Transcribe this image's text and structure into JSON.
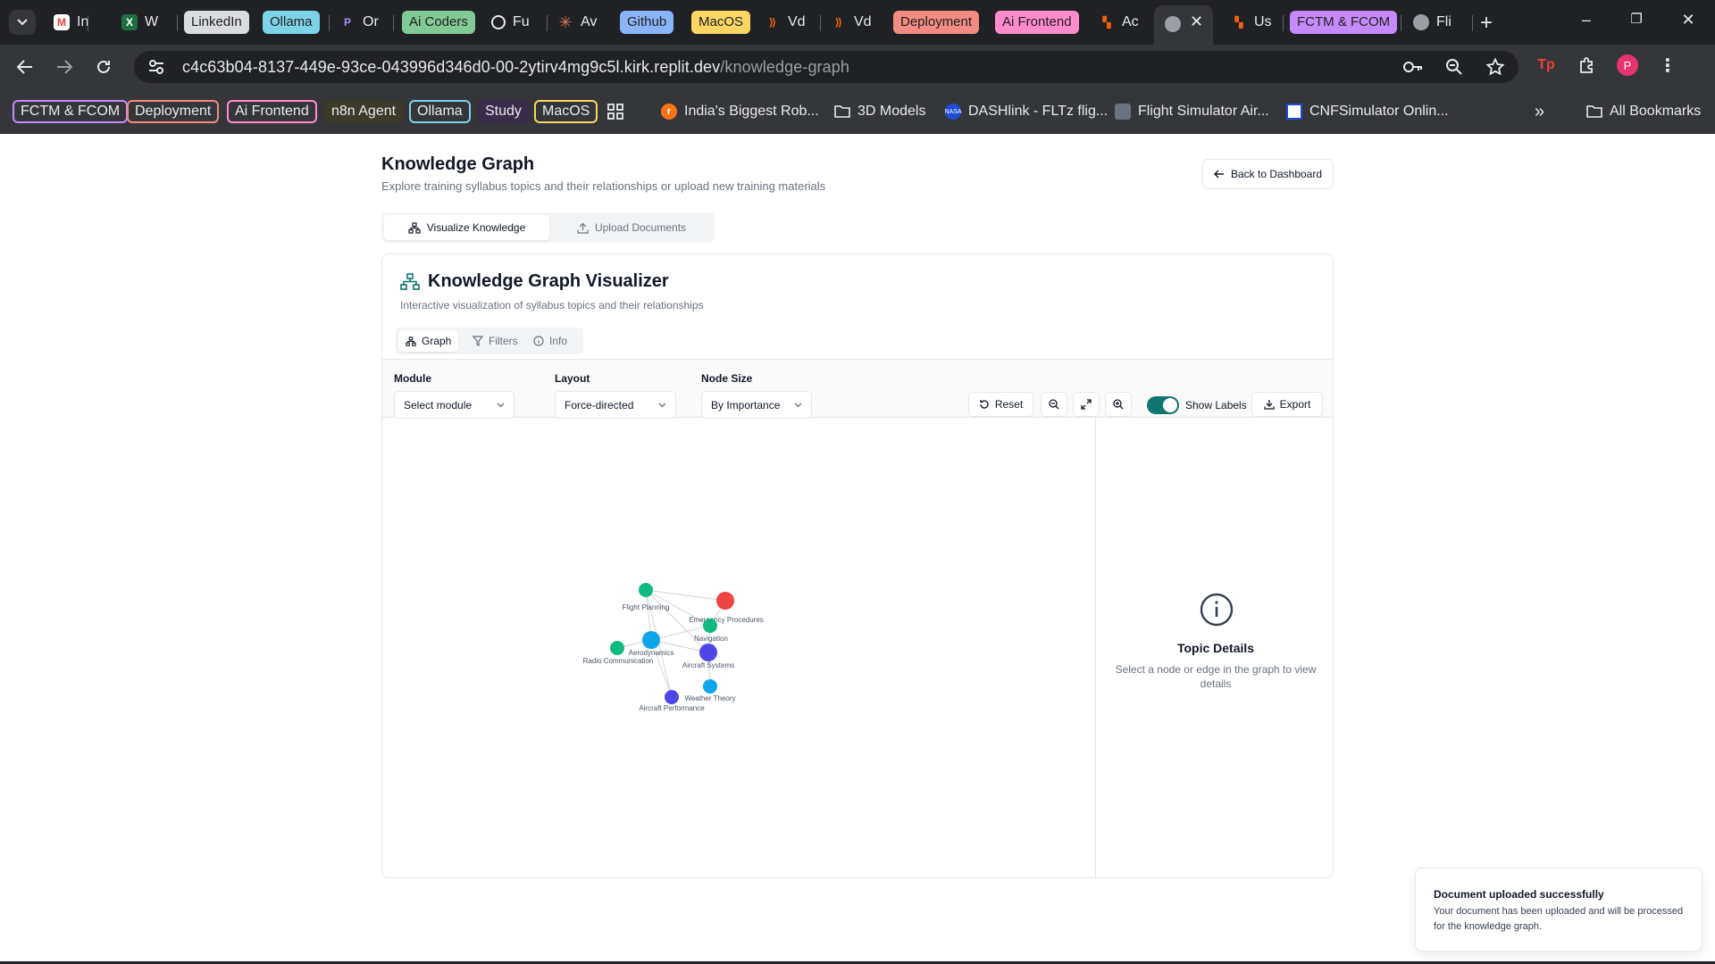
{
  "browser": {
    "tabs": [
      {
        "label": "In",
        "icon": "gmail-icon"
      },
      {
        "label": "W",
        "icon": "excel-icon"
      },
      {
        "group": "LinkedIn",
        "color": "#dadce0"
      },
      {
        "group": "Ollama",
        "color": "#7dd3e8"
      },
      {
        "label": "Or",
        "icon": "openrouter-icon"
      },
      {
        "group": "Ai Coders",
        "color": "#81c995"
      },
      {
        "label": "Fu",
        "icon": "openai-icon"
      },
      {
        "label": "Av",
        "icon": "claude-icon"
      },
      {
        "group": "Github",
        "color": "#8ab4f8"
      },
      {
        "group": "MacOS",
        "color": "#fdd663"
      },
      {
        "label": "Vd",
        "icon": "replit-icon"
      },
      {
        "label": "Vd",
        "icon": "replit-icon"
      },
      {
        "group": "Deployment",
        "color": "#f28b82"
      },
      {
        "group": "Ai Frontend",
        "color": "#ff8bcb"
      },
      {
        "label": "Ac",
        "icon": "replit-icon"
      },
      {
        "label": "",
        "icon": "globe-icon",
        "active": true
      },
      {
        "label": "Us",
        "icon": "replit-icon"
      },
      {
        "group": "FCTM & FCOM",
        "color": "#c58af9"
      },
      {
        "label": "Fli",
        "icon": "globe-icon"
      }
    ],
    "url_host": "c4c63b04-8137-449e-93ce-043996d346d0-00-2ytirv4mg9c5l.kirk.replit.dev",
    "url_path": "/knowledge-graph",
    "bookmarks": [
      {
        "label": "FCTM & FCOM",
        "type": "group",
        "color": "#c58af9"
      },
      {
        "label": "Deployment",
        "type": "group",
        "color": "#f28b82"
      },
      {
        "label": "Ai Frontend",
        "type": "group",
        "color": "#ff8bcb"
      },
      {
        "label": "n8n Agent",
        "type": "group",
        "color": "#fdd663"
      },
      {
        "label": "Ollama",
        "type": "group",
        "color": "#7dd3e8"
      },
      {
        "label": "Study",
        "type": "group",
        "color": "#c58af9"
      },
      {
        "label": "MacOS",
        "type": "group",
        "color": "#fdd663"
      },
      {
        "label": "India's Biggest Rob...",
        "type": "link"
      },
      {
        "label": "3D Models",
        "type": "folder"
      },
      {
        "label": "DASHlink - FLTz flig...",
        "type": "link"
      },
      {
        "label": "Flight Simulator Air...",
        "type": "link"
      },
      {
        "label": "CNFSimulator Onlin...",
        "type": "link"
      },
      {
        "label": "All Bookmarks",
        "type": "folder"
      }
    ],
    "profile_initial": "P"
  },
  "header": {
    "title": "Knowledge Graph",
    "subtitle": "Explore training syllabus topics and their relationships or upload new training materials",
    "back_label": "Back to Dashboard"
  },
  "main_tabs": [
    {
      "label": "Visualize Knowledge",
      "active": true
    },
    {
      "label": "Upload Documents",
      "active": false
    }
  ],
  "visualizer": {
    "title": "Knowledge Graph Visualizer",
    "subtitle": "Interactive visualization of syllabus topics and their relationships",
    "tabs": [
      {
        "label": "Graph",
        "active": true
      },
      {
        "label": "Filters",
        "active": false
      },
      {
        "label": "Info",
        "active": false
      }
    ],
    "controls": {
      "module_label": "Module",
      "module_value": "Select module",
      "layout_label": "Layout",
      "layout_value": "Force-directed",
      "node_size_label": "Node Size",
      "node_size_value": "By Importance",
      "reset_label": "Reset",
      "show_labels_label": "Show Labels",
      "show_labels_on": true,
      "export_label": "Export"
    },
    "graph": {
      "nodes": [
        {
          "label": "Flight Planning",
          "color": "#10b981"
        },
        {
          "label": "Emergency Procedures",
          "color": "#ef4444"
        },
        {
          "label": "Navigation",
          "color": "#10b981"
        },
        {
          "label": "Aerodynamics",
          "color": "#0ea5e9"
        },
        {
          "label": "Radio Communication",
          "color": "#10b981"
        },
        {
          "label": "Aircraft Systems",
          "color": "#4f46e5"
        },
        {
          "label": "Weather Theory",
          "color": "#0ea5e9"
        },
        {
          "label": "Aircraft Performance",
          "color": "#4f46e5"
        }
      ]
    },
    "details": {
      "title": "Topic Details",
      "text": "Select a node or edge in the graph to view details"
    }
  },
  "toast": {
    "title": "Document uploaded successfully",
    "text": "Your document has been uploaded and will be processed for the knowledge graph."
  }
}
